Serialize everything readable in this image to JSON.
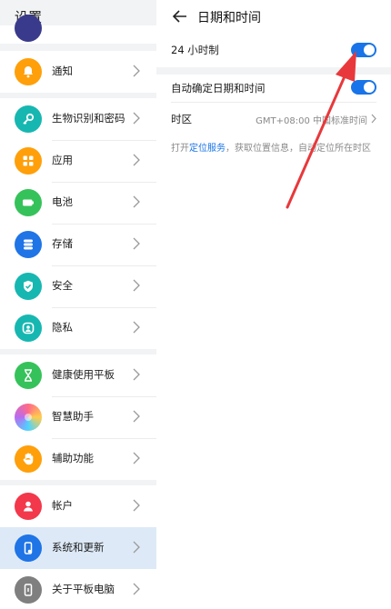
{
  "left": {
    "title": "设置",
    "items": [
      {
        "label": "通知",
        "icon": "bell-icon",
        "color": "#ff9f0a"
      },
      {
        "label": "生物识别和密码",
        "icon": "key-icon",
        "color": "#17b7b1"
      },
      {
        "label": "应用",
        "icon": "apps-icon",
        "color": "#ff9f0a"
      },
      {
        "label": "电池",
        "icon": "battery-icon",
        "color": "#36c25a"
      },
      {
        "label": "存储",
        "icon": "storage-icon",
        "color": "#1f74e6"
      },
      {
        "label": "安全",
        "icon": "shield-icon",
        "color": "#17b7b1"
      },
      {
        "label": "隐私",
        "icon": "privacy-icon",
        "color": "#17b7b1"
      },
      {
        "label": "健康使用平板",
        "icon": "hourglass-icon",
        "color": "#36c25a"
      },
      {
        "label": "智慧助手",
        "icon": "assistant-icon",
        "color": "#b86bf0"
      },
      {
        "label": "辅助功能",
        "icon": "hand-icon",
        "color": "#ff9f0a"
      },
      {
        "label": "帐户",
        "icon": "account-icon",
        "color": "#f2384a"
      },
      {
        "label": "系统和更新",
        "icon": "system-icon",
        "color": "#1f74e6"
      },
      {
        "label": "关于平板电脑",
        "icon": "tablet-icon",
        "color": "#7f7f7f"
      }
    ]
  },
  "right": {
    "title": "日期和时间",
    "hour24_label": "24 小时制",
    "auto_label": "自动确定日期和时间",
    "timezone_label": "时区",
    "timezone_value": "GMT+08:00 中国标准时间",
    "note_prefix": "打开",
    "note_link": "定位服务",
    "note_suffix": "，获取位置信息，自动定位所在时区"
  },
  "colors": {
    "accent": "#1874e8",
    "annotation": "#e8383b"
  }
}
